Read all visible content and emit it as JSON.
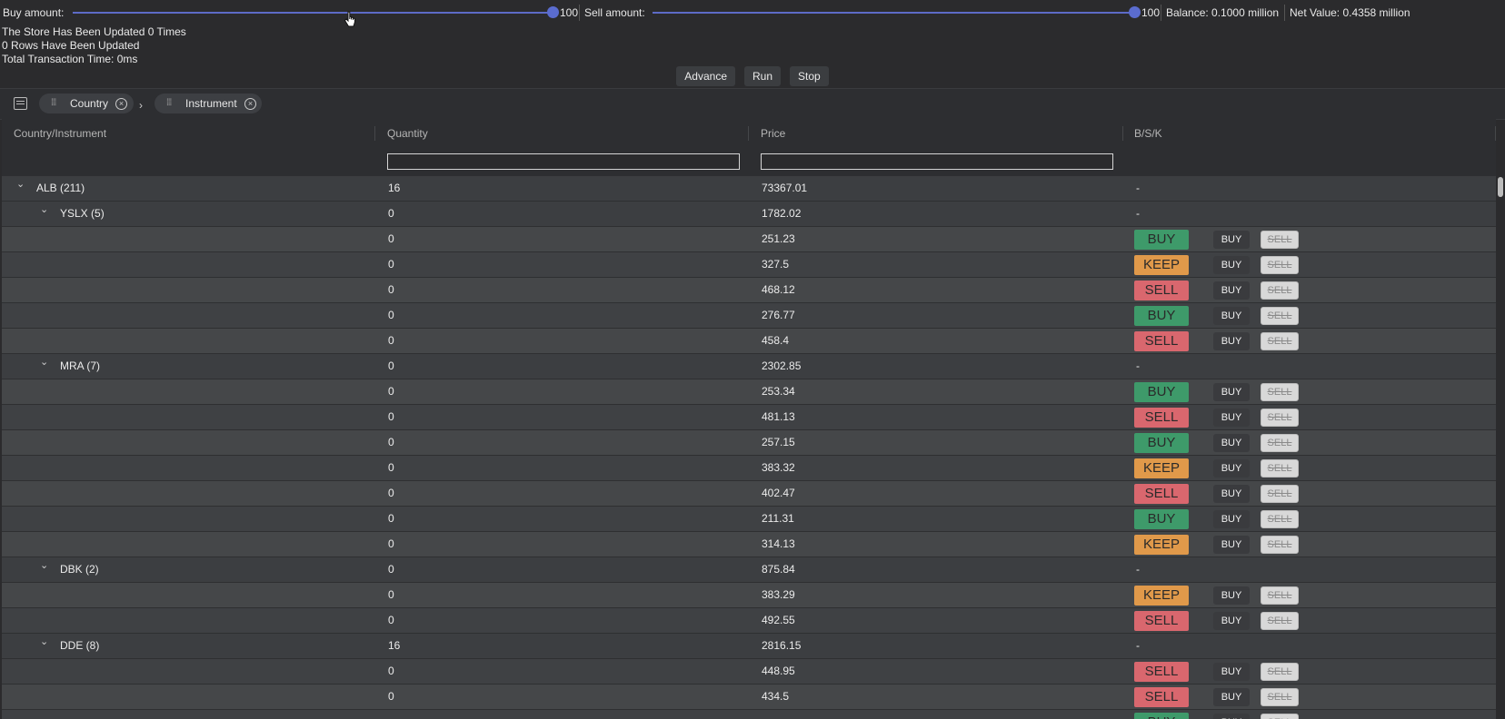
{
  "controls": {
    "buy_label": "Buy amount:",
    "buy_value": "100",
    "buy_level": 1.0,
    "sell_label": "Sell amount:",
    "sell_value": "100",
    "sell_level": 1.0,
    "balance": "Balance: 0.1000 million",
    "net_value": "Net Value: 0.4358 million"
  },
  "status": {
    "store_updated": "The Store Has Been Updated 0 Times",
    "rows_updated": "0 Rows Have Been Updated",
    "transaction_time": "Total Transaction Time: 0ms"
  },
  "actions": {
    "advance": "Advance",
    "run": "Run",
    "stop": "Stop"
  },
  "group_panel": {
    "chips": [
      {
        "label": "Country"
      },
      {
        "label": "Instrument"
      }
    ]
  },
  "grid": {
    "columns": {
      "group": "Country/Instrument",
      "quantity": "Quantity",
      "price": "Price",
      "bsk": "B/S/K"
    },
    "buy_button_label": "BUY",
    "sell_button_label": "SELL",
    "rows": [
      {
        "type": "group",
        "level": 0,
        "label": "ALB (211)",
        "quantity": "16",
        "price": "73367.01",
        "bsk": "-"
      },
      {
        "type": "group",
        "level": 1,
        "label": "YSLX (5)",
        "quantity": "0",
        "price": "1782.02",
        "bsk": "-"
      },
      {
        "type": "leaf",
        "quantity": "0",
        "price": "251.23",
        "bsk": "BUY"
      },
      {
        "type": "leaf",
        "quantity": "0",
        "price": "327.5",
        "bsk": "KEEP"
      },
      {
        "type": "leaf",
        "quantity": "0",
        "price": "468.12",
        "bsk": "SELL"
      },
      {
        "type": "leaf",
        "quantity": "0",
        "price": "276.77",
        "bsk": "BUY"
      },
      {
        "type": "leaf",
        "quantity": "0",
        "price": "458.4",
        "bsk": "SELL"
      },
      {
        "type": "group",
        "level": 1,
        "label": "MRA (7)",
        "quantity": "0",
        "price": "2302.85",
        "bsk": "-"
      },
      {
        "type": "leaf",
        "quantity": "0",
        "price": "253.34",
        "bsk": "BUY"
      },
      {
        "type": "leaf",
        "quantity": "0",
        "price": "481.13",
        "bsk": "SELL"
      },
      {
        "type": "leaf",
        "quantity": "0",
        "price": "257.15",
        "bsk": "BUY"
      },
      {
        "type": "leaf",
        "quantity": "0",
        "price": "383.32",
        "bsk": "KEEP"
      },
      {
        "type": "leaf",
        "quantity": "0",
        "price": "402.47",
        "bsk": "SELL"
      },
      {
        "type": "leaf",
        "quantity": "0",
        "price": "211.31",
        "bsk": "BUY"
      },
      {
        "type": "leaf",
        "quantity": "0",
        "price": "314.13",
        "bsk": "KEEP"
      },
      {
        "type": "group",
        "level": 1,
        "label": "DBK (2)",
        "quantity": "0",
        "price": "875.84",
        "bsk": "-"
      },
      {
        "type": "leaf",
        "quantity": "0",
        "price": "383.29",
        "bsk": "KEEP"
      },
      {
        "type": "leaf",
        "quantity": "0",
        "price": "492.55",
        "bsk": "SELL"
      },
      {
        "type": "group",
        "level": 1,
        "label": "DDE (8)",
        "quantity": "16",
        "price": "2816.15",
        "bsk": "-"
      },
      {
        "type": "leaf",
        "quantity": "0",
        "price": "448.95",
        "bsk": "SELL"
      },
      {
        "type": "leaf",
        "quantity": "0",
        "price": "434.5",
        "bsk": "SELL"
      },
      {
        "type": "leaf",
        "quantity": "",
        "price": "",
        "bsk": "BUY"
      }
    ]
  },
  "colors": {
    "BUY": "#3e9a6a",
    "KEEP": "#e0994a",
    "SELL": "#d9676e",
    "slider_accent": "#5a6ccf"
  }
}
